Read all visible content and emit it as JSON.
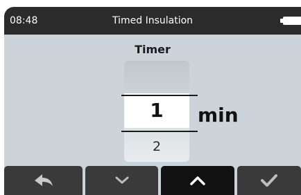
{
  "status": {
    "time": "08:48",
    "title": "Timed Insulation",
    "battery_icon": "battery-icon"
  },
  "screen": {
    "label": "Timer",
    "picker": {
      "previous": "",
      "selected": "1",
      "next": "2"
    },
    "unit": "min"
  },
  "softkeys": [
    {
      "icon": "back-icon"
    },
    {
      "icon": "chevron-down-icon"
    },
    {
      "icon": "chevron-up-icon",
      "active": true
    },
    {
      "icon": "checkmark-icon"
    }
  ]
}
